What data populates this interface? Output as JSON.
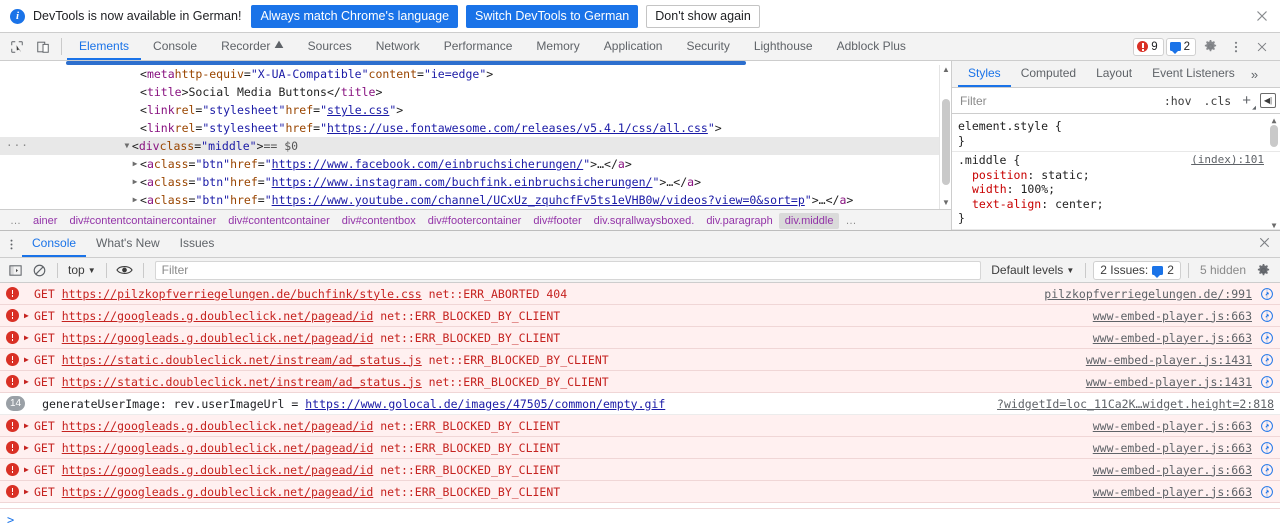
{
  "infobar": {
    "message": "DevTools is now available in German!",
    "primary_button": "Always match Chrome's language",
    "secondary_button": "Switch DevTools to German",
    "dismiss_button": "Don't show again",
    "close_icon": "close-icon",
    "accent_color": "#1a73e8"
  },
  "main_tabbar": {
    "inspect_icon": "inspect-element-icon",
    "device_icon": "device-toolbar-icon",
    "tabs": [
      {
        "label": "Elements",
        "active": true
      },
      {
        "label": "Console",
        "active": false
      },
      {
        "label": "Recorder",
        "active": false,
        "glyph": "experiment-flask-icon"
      },
      {
        "label": "Sources",
        "active": false
      },
      {
        "label": "Network",
        "active": false
      },
      {
        "label": "Performance",
        "active": false
      },
      {
        "label": "Memory",
        "active": false
      },
      {
        "label": "Application",
        "active": false
      },
      {
        "label": "Security",
        "active": false
      },
      {
        "label": "Lighthouse",
        "active": false
      },
      {
        "label": "Adblock Plus",
        "active": false
      }
    ],
    "error_count": "9",
    "message_count": "2",
    "settings_icon": "gear-icon",
    "more_icon": "more-vertical-icon",
    "close_icon": "close-icon"
  },
  "elements": {
    "nodes": [
      {
        "indent": 130,
        "arrow": "",
        "parts": [
          {
            "t": "punct",
            "v": "<"
          },
          {
            "t": "tag",
            "v": "meta"
          },
          {
            "t": "punct",
            "v": " "
          },
          {
            "t": "attr",
            "v": "http-equiv"
          },
          {
            "t": "punct",
            "v": "="
          },
          {
            "t": "val",
            "v": "\"X-UA-Compatible\""
          },
          {
            "t": "punct",
            "v": " "
          },
          {
            "t": "attr",
            "v": "content"
          },
          {
            "t": "punct",
            "v": "="
          },
          {
            "t": "val",
            "v": "\"ie=edge\""
          },
          {
            "t": "punct",
            "v": ">"
          }
        ]
      },
      {
        "indent": 130,
        "arrow": "",
        "parts": [
          {
            "t": "punct",
            "v": "<"
          },
          {
            "t": "tag",
            "v": "title"
          },
          {
            "t": "punct",
            "v": ">"
          },
          {
            "t": "txt",
            "v": "Social Media Buttons"
          },
          {
            "t": "punct",
            "v": "</"
          },
          {
            "t": "tag",
            "v": "title"
          },
          {
            "t": "punct",
            "v": ">"
          }
        ]
      },
      {
        "indent": 130,
        "arrow": "",
        "parts": [
          {
            "t": "punct",
            "v": "<"
          },
          {
            "t": "tag",
            "v": "link"
          },
          {
            "t": "punct",
            "v": " "
          },
          {
            "t": "attr",
            "v": "rel"
          },
          {
            "t": "punct",
            "v": "="
          },
          {
            "t": "val",
            "v": "\"stylesheet\""
          },
          {
            "t": "punct",
            "v": " "
          },
          {
            "t": "attr",
            "v": "href"
          },
          {
            "t": "punct",
            "v": "="
          },
          {
            "t": "val",
            "v": "\""
          },
          {
            "t": "lnk",
            "v": "style.css"
          },
          {
            "t": "val",
            "v": "\""
          },
          {
            "t": "punct",
            "v": ">"
          }
        ]
      },
      {
        "indent": 130,
        "arrow": "",
        "parts": [
          {
            "t": "punct",
            "v": "<"
          },
          {
            "t": "tag",
            "v": "link"
          },
          {
            "t": "punct",
            "v": " "
          },
          {
            "t": "attr",
            "v": "rel"
          },
          {
            "t": "punct",
            "v": "="
          },
          {
            "t": "val",
            "v": "\"stylesheet\""
          },
          {
            "t": "punct",
            "v": " "
          },
          {
            "t": "attr",
            "v": "href"
          },
          {
            "t": "punct",
            "v": "="
          },
          {
            "t": "val",
            "v": "\""
          },
          {
            "t": "lnk",
            "v": "https://use.fontawesome.com/releases/v5.4.1/css/all.css"
          },
          {
            "t": "val",
            "v": "\""
          },
          {
            "t": "punct",
            "v": ">"
          }
        ]
      },
      {
        "indent": 117,
        "arrow": "▼",
        "selected": true,
        "leading_dots": "···",
        "parts": [
          {
            "t": "punct",
            "v": "<"
          },
          {
            "t": "tag",
            "v": "div"
          },
          {
            "t": "punct",
            "v": " "
          },
          {
            "t": "attr",
            "v": "class"
          },
          {
            "t": "punct",
            "v": "="
          },
          {
            "t": "val",
            "v": "\"middle\""
          },
          {
            "t": "punct",
            "v": ">"
          },
          {
            "t": "dollar",
            "v": " == $0"
          }
        ]
      },
      {
        "indent": 130,
        "arrow": "▶",
        "parts": [
          {
            "t": "punct",
            "v": "<"
          },
          {
            "t": "tag",
            "v": "a"
          },
          {
            "t": "punct",
            "v": " "
          },
          {
            "t": "attr",
            "v": "class"
          },
          {
            "t": "punct",
            "v": "="
          },
          {
            "t": "val",
            "v": "\"btn\""
          },
          {
            "t": "punct",
            "v": " "
          },
          {
            "t": "attr",
            "v": "href"
          },
          {
            "t": "punct",
            "v": "="
          },
          {
            "t": "val",
            "v": "\""
          },
          {
            "t": "lnk",
            "v": "https://www.facebook.com/einbruchsicherungen/"
          },
          {
            "t": "val",
            "v": "\""
          },
          {
            "t": "punct",
            "v": ">"
          },
          {
            "t": "txt",
            "v": "…"
          },
          {
            "t": "punct",
            "v": "</"
          },
          {
            "t": "tag",
            "v": "a"
          },
          {
            "t": "punct",
            "v": ">"
          }
        ]
      },
      {
        "indent": 130,
        "arrow": "▶",
        "parts": [
          {
            "t": "punct",
            "v": "<"
          },
          {
            "t": "tag",
            "v": "a"
          },
          {
            "t": "punct",
            "v": " "
          },
          {
            "t": "attr",
            "v": "class"
          },
          {
            "t": "punct",
            "v": "="
          },
          {
            "t": "val",
            "v": "\"btn\""
          },
          {
            "t": "punct",
            "v": " "
          },
          {
            "t": "attr",
            "v": "href"
          },
          {
            "t": "punct",
            "v": "="
          },
          {
            "t": "val",
            "v": "\""
          },
          {
            "t": "lnk",
            "v": "https://www.instagram.com/buchfink.einbruchsicherungen/"
          },
          {
            "t": "val",
            "v": "\""
          },
          {
            "t": "punct",
            "v": ">"
          },
          {
            "t": "txt",
            "v": "…"
          },
          {
            "t": "punct",
            "v": "</"
          },
          {
            "t": "tag",
            "v": "a"
          },
          {
            "t": "punct",
            "v": ">"
          }
        ]
      },
      {
        "indent": 130,
        "arrow": "▶",
        "parts": [
          {
            "t": "punct",
            "v": "<"
          },
          {
            "t": "tag",
            "v": "a"
          },
          {
            "t": "punct",
            "v": " "
          },
          {
            "t": "attr",
            "v": "class"
          },
          {
            "t": "punct",
            "v": "="
          },
          {
            "t": "val",
            "v": "\"btn\""
          },
          {
            "t": "punct",
            "v": " "
          },
          {
            "t": "attr",
            "v": "href"
          },
          {
            "t": "punct",
            "v": "="
          },
          {
            "t": "val",
            "v": "\""
          },
          {
            "t": "lnk",
            "v": "https://www.youtube.com/channel/UCxUz_zquhcfFv5ts1eVHB0w/videos?view=0&sort=p"
          },
          {
            "t": "val",
            "v": "\""
          },
          {
            "t": "punct",
            "v": ">"
          },
          {
            "t": "txt",
            "v": "…"
          },
          {
            "t": "punct",
            "v": "</"
          },
          {
            "t": "tag",
            "v": "a"
          },
          {
            "t": "punct",
            "v": ">"
          }
        ]
      }
    ],
    "breadcrumbs": [
      {
        "label": "…",
        "style": "muted"
      },
      {
        "label": "ainer",
        "style": "cut"
      },
      {
        "label": "div#contentcontainercontainer",
        "style": "normal"
      },
      {
        "label": "div#contentcontainer",
        "style": "normal"
      },
      {
        "label": "div#contentbox",
        "style": "normal"
      },
      {
        "label": "div#footercontainer",
        "style": "normal"
      },
      {
        "label": "div#footer",
        "style": "normal"
      },
      {
        "label": "div.sqrallwaysboxed.",
        "style": "normal"
      },
      {
        "label": "div.paragraph",
        "style": "normal"
      },
      {
        "label": "div.middle",
        "style": "last"
      },
      {
        "label": "…",
        "style": "muted"
      }
    ]
  },
  "styles_pane": {
    "tabs": [
      {
        "label": "Styles",
        "active": true
      },
      {
        "label": "Computed",
        "active": false
      },
      {
        "label": "Layout",
        "active": false
      },
      {
        "label": "Event Listeners",
        "active": false
      }
    ],
    "overflow_icon": "chevron-double-right-icon",
    "filter_placeholder": "Filter",
    "filter_value": "",
    "hov_label": ":hov",
    "cls_label": ".cls",
    "new_rule_icon": "plus-icon",
    "sidebar_toggle_icon": "toggle-sidebar-icon",
    "rules": [
      {
        "selector": "element.style {",
        "source": "",
        "declarations": [],
        "close": "}"
      },
      {
        "selector": ".middle {",
        "source": "(index):101",
        "declarations": [
          {
            "prop": "position",
            "value": "static;"
          },
          {
            "prop": "width",
            "value": "100%;"
          },
          {
            "prop": "text-align",
            "value": "center;"
          }
        ],
        "close": "}"
      }
    ]
  },
  "drawer": {
    "kebab_icon": "more-vertical-icon",
    "tabs": [
      {
        "label": "Console",
        "active": true
      },
      {
        "label": "What's New",
        "active": false
      },
      {
        "label": "Issues",
        "active": false
      }
    ],
    "close_icon": "close-icon",
    "toolbar": {
      "sidebar_icon": "console-sidebar-icon",
      "clear_icon": "clear-console-icon",
      "context_label": "top",
      "eye_icon": "live-expression-icon",
      "filter_placeholder": "Filter",
      "filter_value": "",
      "levels_label": "Default levels",
      "issues_label": "2 Issues:",
      "issues_count": "2",
      "hidden_label": "5 hidden",
      "settings_icon": "gear-icon"
    },
    "prompt_glyph": ">",
    "messages": [
      {
        "kind": "error",
        "expandable": false,
        "text_segments": [
          {
            "t": "plain",
            "v": "GET "
          },
          {
            "t": "link",
            "v": "https://pilzkopfverriegelungen.de/buchfink/style.css"
          },
          {
            "t": "plain",
            "v": " net::ERR_ABORTED 404"
          }
        ],
        "source": "pilzkopfverriegelungen.de/:991",
        "has_link_icon": true
      },
      {
        "kind": "error",
        "expandable": true,
        "text_segments": [
          {
            "t": "plain",
            "v": "GET "
          },
          {
            "t": "link",
            "v": "https://googleads.g.doubleclick.net/pagead/id"
          },
          {
            "t": "plain",
            "v": " net::ERR_BLOCKED_BY_CLIENT"
          }
        ],
        "source": "www-embed-player.js:663",
        "has_link_icon": true
      },
      {
        "kind": "error",
        "expandable": true,
        "text_segments": [
          {
            "t": "plain",
            "v": "GET "
          },
          {
            "t": "link",
            "v": "https://googleads.g.doubleclick.net/pagead/id"
          },
          {
            "t": "plain",
            "v": " net::ERR_BLOCKED_BY_CLIENT"
          }
        ],
        "source": "www-embed-player.js:663",
        "has_link_icon": true
      },
      {
        "kind": "error",
        "expandable": true,
        "text_segments": [
          {
            "t": "plain",
            "v": "GET "
          },
          {
            "t": "link",
            "v": "https://static.doubleclick.net/instream/ad_status.js"
          },
          {
            "t": "plain",
            "v": " net::ERR_BLOCKED_BY_CLIENT"
          }
        ],
        "source": "www-embed-player.js:1431",
        "has_link_icon": true
      },
      {
        "kind": "error",
        "expandable": true,
        "text_segments": [
          {
            "t": "plain",
            "v": "GET "
          },
          {
            "t": "link",
            "v": "https://static.doubleclick.net/instream/ad_status.js"
          },
          {
            "t": "plain",
            "v": " net::ERR_BLOCKED_BY_CLIENT"
          }
        ],
        "source": "www-embed-player.js:1431",
        "has_link_icon": true
      },
      {
        "kind": "info",
        "count": "14",
        "expandable": false,
        "text_segments": [
          {
            "t": "plain",
            "v": "generateUserImage: rev.userImageUrl = "
          },
          {
            "t": "link",
            "v": "https://www.golocal.de/images/47505/common/empty.gif"
          }
        ],
        "source": "?widgetId=loc_11Ca2K…widget.height=2:818",
        "has_link_icon": false
      },
      {
        "kind": "error",
        "expandable": true,
        "text_segments": [
          {
            "t": "plain",
            "v": "GET "
          },
          {
            "t": "link",
            "v": "https://googleads.g.doubleclick.net/pagead/id"
          },
          {
            "t": "plain",
            "v": " net::ERR_BLOCKED_BY_CLIENT"
          }
        ],
        "source": "www-embed-player.js:663",
        "has_link_icon": true
      },
      {
        "kind": "error",
        "expandable": true,
        "text_segments": [
          {
            "t": "plain",
            "v": "GET "
          },
          {
            "t": "link",
            "v": "https://googleads.g.doubleclick.net/pagead/id"
          },
          {
            "t": "plain",
            "v": " net::ERR_BLOCKED_BY_CLIENT"
          }
        ],
        "source": "www-embed-player.js:663",
        "has_link_icon": true
      },
      {
        "kind": "error",
        "expandable": true,
        "text_segments": [
          {
            "t": "plain",
            "v": "GET "
          },
          {
            "t": "link",
            "v": "https://googleads.g.doubleclick.net/pagead/id"
          },
          {
            "t": "plain",
            "v": " net::ERR_BLOCKED_BY_CLIENT"
          }
        ],
        "source": "www-embed-player.js:663",
        "has_link_icon": true
      },
      {
        "kind": "error",
        "expandable": true,
        "text_segments": [
          {
            "t": "plain",
            "v": "GET "
          },
          {
            "t": "link",
            "v": "https://googleads.g.doubleclick.net/pagead/id"
          },
          {
            "t": "plain",
            "v": " net::ERR_BLOCKED_BY_CLIENT"
          }
        ],
        "source": "www-embed-player.js:663",
        "has_link_icon": true
      }
    ]
  }
}
